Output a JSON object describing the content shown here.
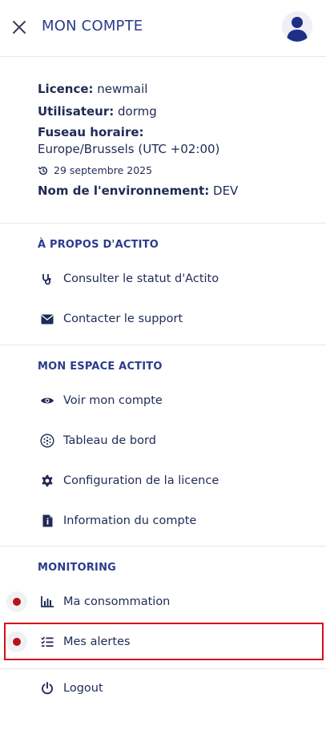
{
  "header": {
    "title": "MON COMPTE",
    "close_icon": "close-icon",
    "avatar_icon": "user-icon"
  },
  "account": {
    "licence_label": "Licence:",
    "licence_value": "newmail",
    "user_label": "Utilisateur:",
    "user_value": "dormg",
    "timezone_label": "Fuseau horaire:",
    "timezone_value": "Europe/Brussels (UTC +02:00)",
    "date_icon": "history-icon",
    "date_value": "29 septembre 2025",
    "env_label": "Nom de l'environnement:",
    "env_value": "DEV"
  },
  "sections": {
    "about": {
      "title": "À PROPOS D'ACTITO",
      "items": [
        {
          "label": "Consulter le statut d'Actito",
          "icon": "stethoscope-icon"
        },
        {
          "label": "Contacter le support",
          "icon": "envelope-icon"
        }
      ]
    },
    "space": {
      "title": "MON ESPACE ACTITO",
      "items": [
        {
          "label": "Voir mon compte",
          "icon": "eye-icon"
        },
        {
          "label": "Tableau de bord",
          "icon": "dashboard-icon"
        },
        {
          "label": "Configuration de la licence",
          "icon": "gear-icon"
        },
        {
          "label": "Information du compte",
          "icon": "file-info-icon"
        }
      ]
    },
    "monitoring": {
      "title": "MONITORING",
      "items": [
        {
          "label": "Ma consommation",
          "icon": "bar-chart-icon",
          "alert": true
        },
        {
          "label": "Mes alertes",
          "icon": "checklist-icon",
          "alert": true,
          "selected": true
        }
      ]
    }
  },
  "logout": {
    "label": "Logout",
    "icon": "power-icon"
  },
  "colors": {
    "accent": "#2a3c8c",
    "text": "#1f2a55",
    "alert": "#b5121b",
    "highlight": "#d40f18"
  }
}
